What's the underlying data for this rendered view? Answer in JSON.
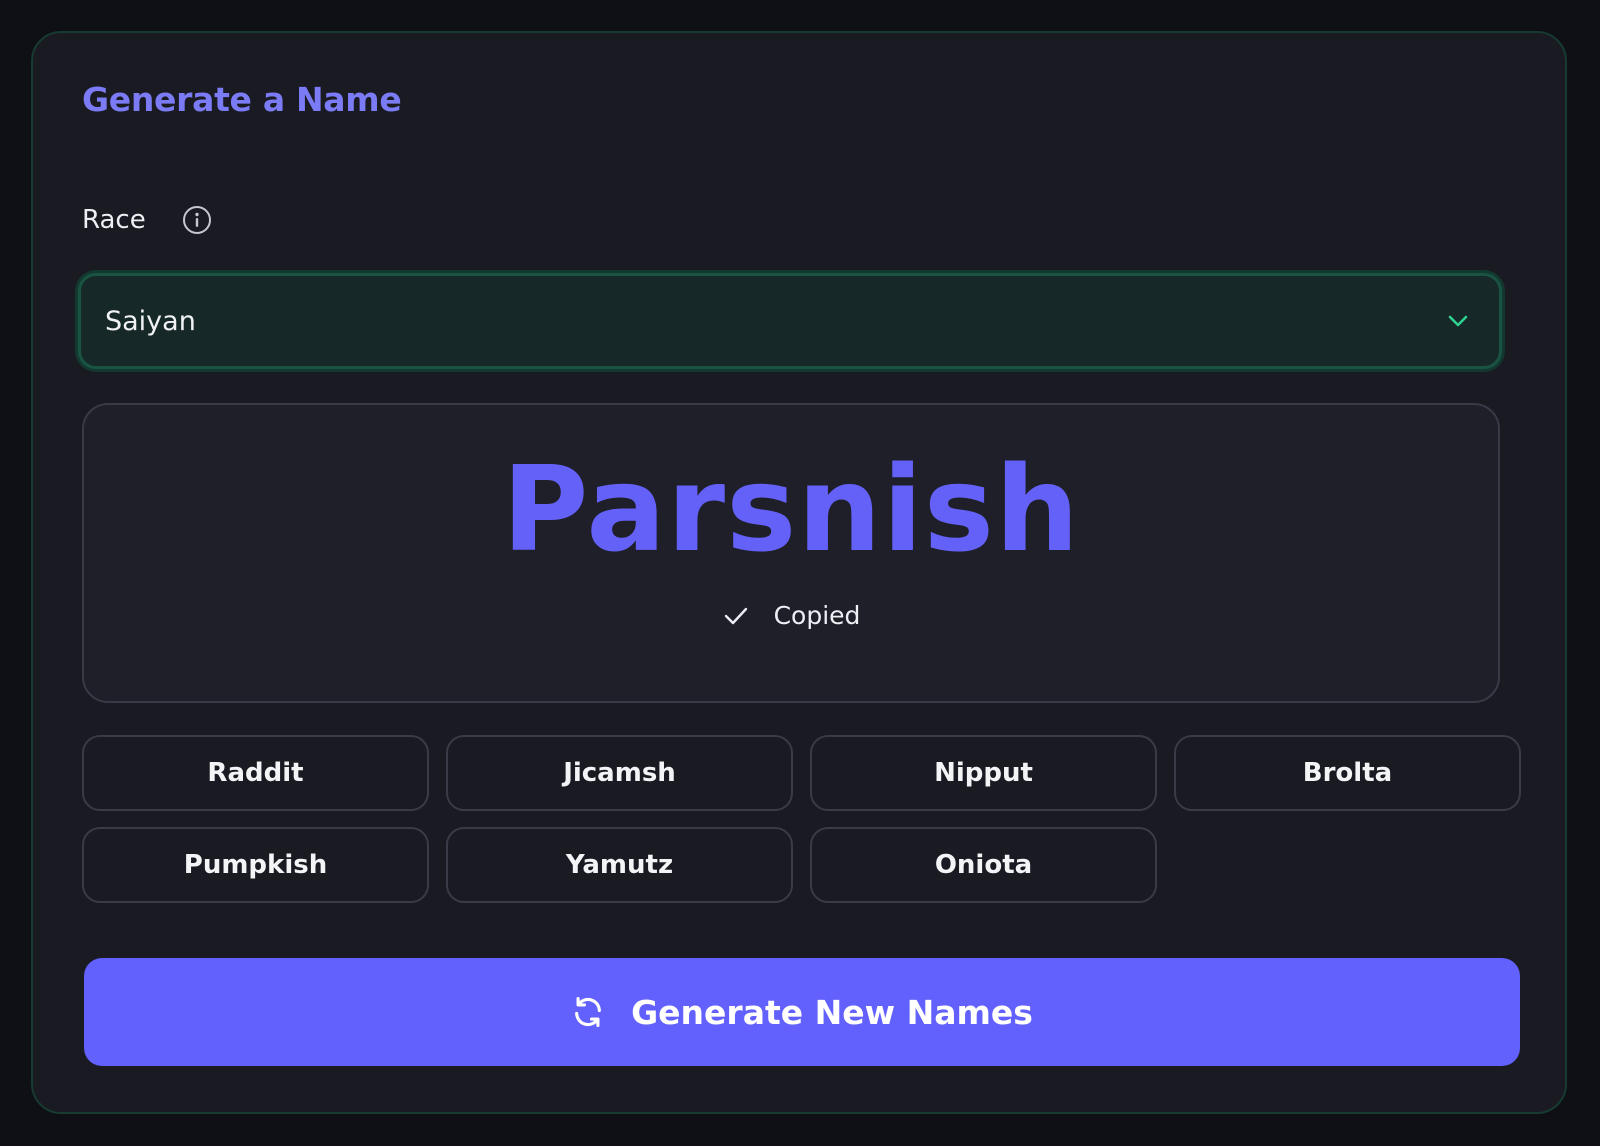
{
  "card": {
    "title": "Generate a Name"
  },
  "race": {
    "label": "Race",
    "info_icon": "info-circle-icon",
    "selected": "Saiyan",
    "chevron_icon": "chevron-down-icon"
  },
  "result": {
    "name": "Parsnish",
    "status_icon": "check-icon",
    "status": "Copied"
  },
  "names": [
    "Raddit",
    "Jicamsh",
    "Nipput",
    "Brolta",
    "Pumpkish",
    "Yamutz",
    "Oniota"
  ],
  "generate": {
    "icon": "refresh-icon",
    "label": "Generate New Names"
  },
  "colors": {
    "accent": "#6361fd",
    "title": "#7b7cf5",
    "select_border": "#195443",
    "chevron": "#2fd191"
  }
}
